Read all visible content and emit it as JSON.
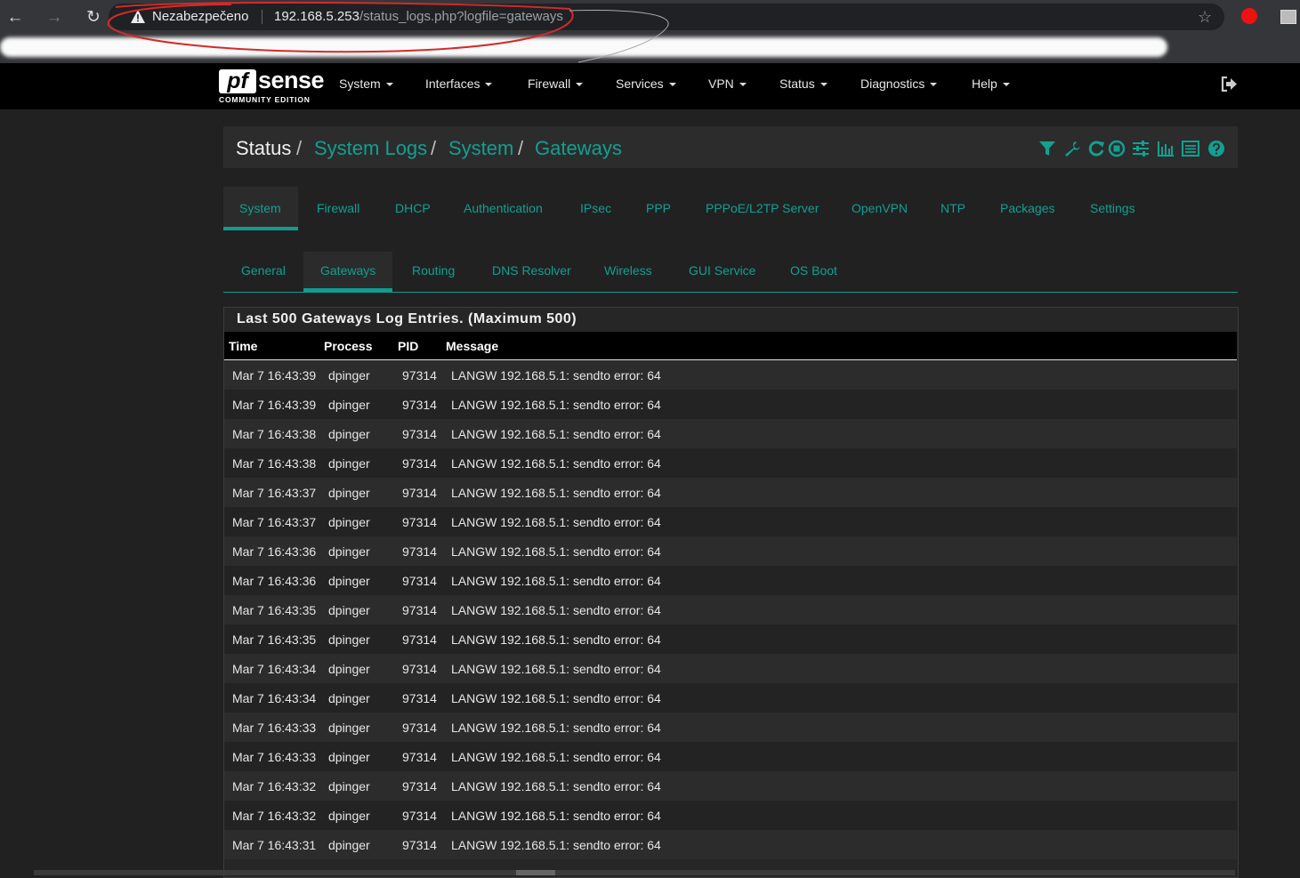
{
  "browser": {
    "security_label": "Nezabezpečeno",
    "url_host": "192.168.5.253",
    "url_path": "/status_logs.php?logfile=gateways",
    "icons": [
      "back-icon",
      "forward-icon",
      "reload-icon",
      "warning-icon",
      "star-icon",
      "extension-icon",
      "profile-icon"
    ]
  },
  "brand": {
    "logo_pf": "pf",
    "logo_sense": "sense",
    "edition": "COMMUNITY EDITION"
  },
  "menu": [
    "System",
    "Interfaces",
    "Firewall",
    "Services",
    "VPN",
    "Status",
    "Diagnostics",
    "Help"
  ],
  "breadcrumb": {
    "root": "Status",
    "items": [
      "System Logs",
      "System",
      "Gateways"
    ],
    "sep": "/"
  },
  "header_icons": [
    "filter-icon",
    "wrench-icon",
    "refresh-icon",
    "stop-icon",
    "sliders-icon",
    "chart-icon",
    "list-icon",
    "help-icon"
  ],
  "tabs": [
    "System",
    "Firewall",
    "DHCP",
    "Authentication",
    "IPsec",
    "PPP",
    "PPPoE/L2TP Server",
    "OpenVPN",
    "NTP",
    "Packages",
    "Settings"
  ],
  "active_tab": "System",
  "subtabs": [
    "General",
    "Gateways",
    "Routing",
    "DNS Resolver",
    "Wireless",
    "GUI Service",
    "OS Boot"
  ],
  "active_subtab": "Gateways",
  "log": {
    "title": "Last 500 Gateways Log Entries. (Maximum 500)",
    "columns": [
      "Time",
      "Process",
      "PID",
      "Message"
    ],
    "rows": [
      [
        "Mar 7 16:43:39",
        "dpinger",
        "97314",
        "LANGW 192.168.5.1: sendto error: 64"
      ],
      [
        "Mar 7 16:43:39",
        "dpinger",
        "97314",
        "LANGW 192.168.5.1: sendto error: 64"
      ],
      [
        "Mar 7 16:43:38",
        "dpinger",
        "97314",
        "LANGW 192.168.5.1: sendto error: 64"
      ],
      [
        "Mar 7 16:43:38",
        "dpinger",
        "97314",
        "LANGW 192.168.5.1: sendto error: 64"
      ],
      [
        "Mar 7 16:43:37",
        "dpinger",
        "97314",
        "LANGW 192.168.5.1: sendto error: 64"
      ],
      [
        "Mar 7 16:43:37",
        "dpinger",
        "97314",
        "LANGW 192.168.5.1: sendto error: 64"
      ],
      [
        "Mar 7 16:43:36",
        "dpinger",
        "97314",
        "LANGW 192.168.5.1: sendto error: 64"
      ],
      [
        "Mar 7 16:43:36",
        "dpinger",
        "97314",
        "LANGW 192.168.5.1: sendto error: 64"
      ],
      [
        "Mar 7 16:43:35",
        "dpinger",
        "97314",
        "LANGW 192.168.5.1: sendto error: 64"
      ],
      [
        "Mar 7 16:43:35",
        "dpinger",
        "97314",
        "LANGW 192.168.5.1: sendto error: 64"
      ],
      [
        "Mar 7 16:43:34",
        "dpinger",
        "97314",
        "LANGW 192.168.5.1: sendto error: 64"
      ],
      [
        "Mar 7 16:43:34",
        "dpinger",
        "97314",
        "LANGW 192.168.5.1: sendto error: 64"
      ],
      [
        "Mar 7 16:43:33",
        "dpinger",
        "97314",
        "LANGW 192.168.5.1: sendto error: 64"
      ],
      [
        "Mar 7 16:43:33",
        "dpinger",
        "97314",
        "LANGW 192.168.5.1: sendto error: 64"
      ],
      [
        "Mar 7 16:43:32",
        "dpinger",
        "97314",
        "LANGW 192.168.5.1: sendto error: 64"
      ],
      [
        "Mar 7 16:43:32",
        "dpinger",
        "97314",
        "LANGW 192.168.5.1: sendto error: 64"
      ],
      [
        "Mar 7 16:43:31",
        "dpinger",
        "97314",
        "LANGW 192.168.5.1: sendto error: 64"
      ]
    ]
  },
  "colors": {
    "accent": "#11a092",
    "page_bg": "#212121",
    "navbar_bg": "#000000"
  }
}
